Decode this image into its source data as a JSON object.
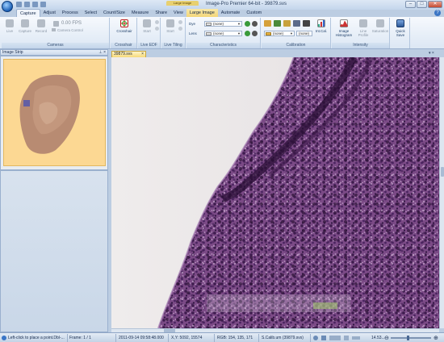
{
  "app": {
    "title": "Image-Pro Premier 64-bit - 39879.svs",
    "context_tab_label": "Large Image"
  },
  "tabs": [
    {
      "label": "Capture",
      "active": true
    },
    {
      "label": "Adjust"
    },
    {
      "label": "Process"
    },
    {
      "label": "Select"
    },
    {
      "label": "Count/Size"
    },
    {
      "label": "Measure"
    },
    {
      "label": "Share"
    },
    {
      "label": "View"
    },
    {
      "label": "Large Image",
      "contextual": true
    },
    {
      "label": "Automate"
    },
    {
      "label": "Custom"
    }
  ],
  "ribbon": {
    "cameras": {
      "live": "Live",
      "capture": "Capture",
      "record": "Record",
      "fps": "0.00 FPS",
      "camera_control": "Camera Control",
      "group_label": "Cameras"
    },
    "crosshair": {
      "button": "Crosshair",
      "group_label": "Crosshair"
    },
    "live_edf": {
      "button": "Start",
      "group_label": "Live EDF"
    },
    "live_tiling": {
      "button": "Start",
      "group_label": "Live Tiling"
    },
    "characteristics": {
      "dye_label": "Dye",
      "lens_label": "Lens",
      "dye_value": "(none)",
      "lens_value": "(none)",
      "group_label": "Characteristics"
    },
    "calibration": {
      "combo1": "(none)",
      "combo2": "(none)",
      "intcal": "Int.Cal.",
      "group_label": "Calibration"
    },
    "intensity": {
      "histogram": "Image Histogram",
      "line_profile": "Line Profile",
      "saturation": "Saturation",
      "group_label": "Intensity"
    },
    "quick_save": {
      "label": "Quick Save"
    }
  },
  "image_strip": {
    "title": "Image Strip"
  },
  "document": {
    "tab_label": "39879.svs"
  },
  "status": {
    "hint": "Left-click to place a point.Dbl-...",
    "frame": "Frame: 1 / 1",
    "datetime": "2011-09-14 09:58:48.000",
    "xy": "X,Y: 5092, 15574",
    "rgb": "RGB: 154, 135, 171",
    "calib": "S.Calib.um (39879.svs)",
    "zoom": "14.53..."
  },
  "colors": {
    "accent": "#2b5797",
    "context_tab": "#f3d679",
    "tissue": "#6d3c78"
  }
}
